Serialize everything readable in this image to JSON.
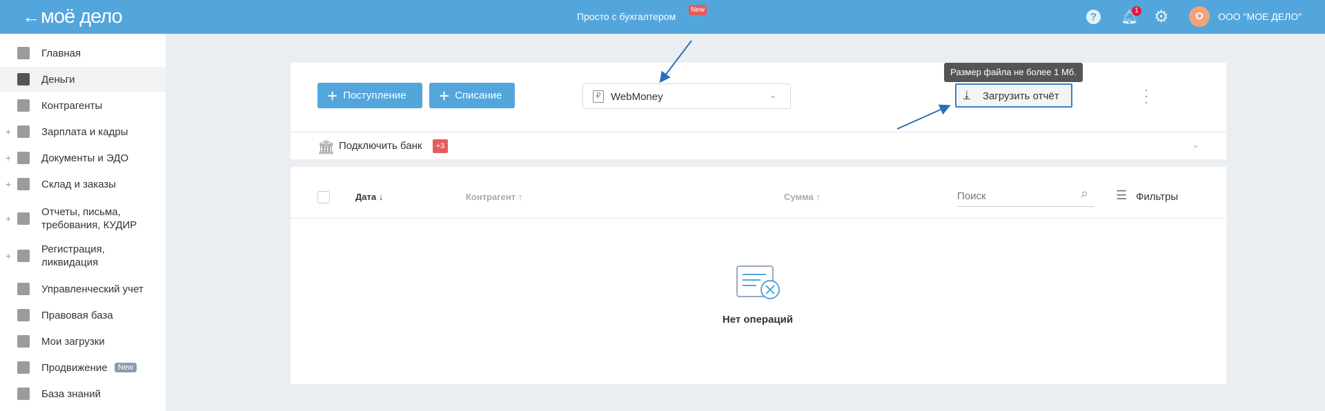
{
  "header": {
    "logo": "моё дело",
    "promo": "Просто с бухгалтером",
    "promo_badge": "New",
    "notifications": "1",
    "avatar_letter": "О",
    "org": "ООО \"МОЕ ДЕЛО\""
  },
  "sidebar": {
    "items": [
      {
        "label": "Главная"
      },
      {
        "label": "Деньги"
      },
      {
        "label": "Контрагенты"
      },
      {
        "label": "Зарплата и кадры"
      },
      {
        "label": "Документы и ЭДО"
      },
      {
        "label": "Склад и заказы"
      },
      {
        "label": "Отчеты, письма,\nтребования, КУДИР"
      },
      {
        "label": "Регистрация,\nликвидация"
      },
      {
        "label": "Управленческий учет"
      },
      {
        "label": "Правовая база"
      },
      {
        "label": "Мои загрузки"
      },
      {
        "label": "Продвижение",
        "badge": "New"
      },
      {
        "label": "База знаний"
      }
    ]
  },
  "toolbar": {
    "income": "Поступление",
    "expense": "Списание",
    "account": "WebMoney",
    "tooltip": "Размер файла не более 1 Мб.",
    "upload": "Загрузить отчёт"
  },
  "bank": {
    "label": "Подключить банк",
    "badge": "+3"
  },
  "table": {
    "date": "Дата ↓",
    "contractor": "Контрагент ↑",
    "sum": "Сумма ↑",
    "search_placeholder": "Поиск",
    "filters": "Фильтры",
    "empty": "Нет операций"
  }
}
